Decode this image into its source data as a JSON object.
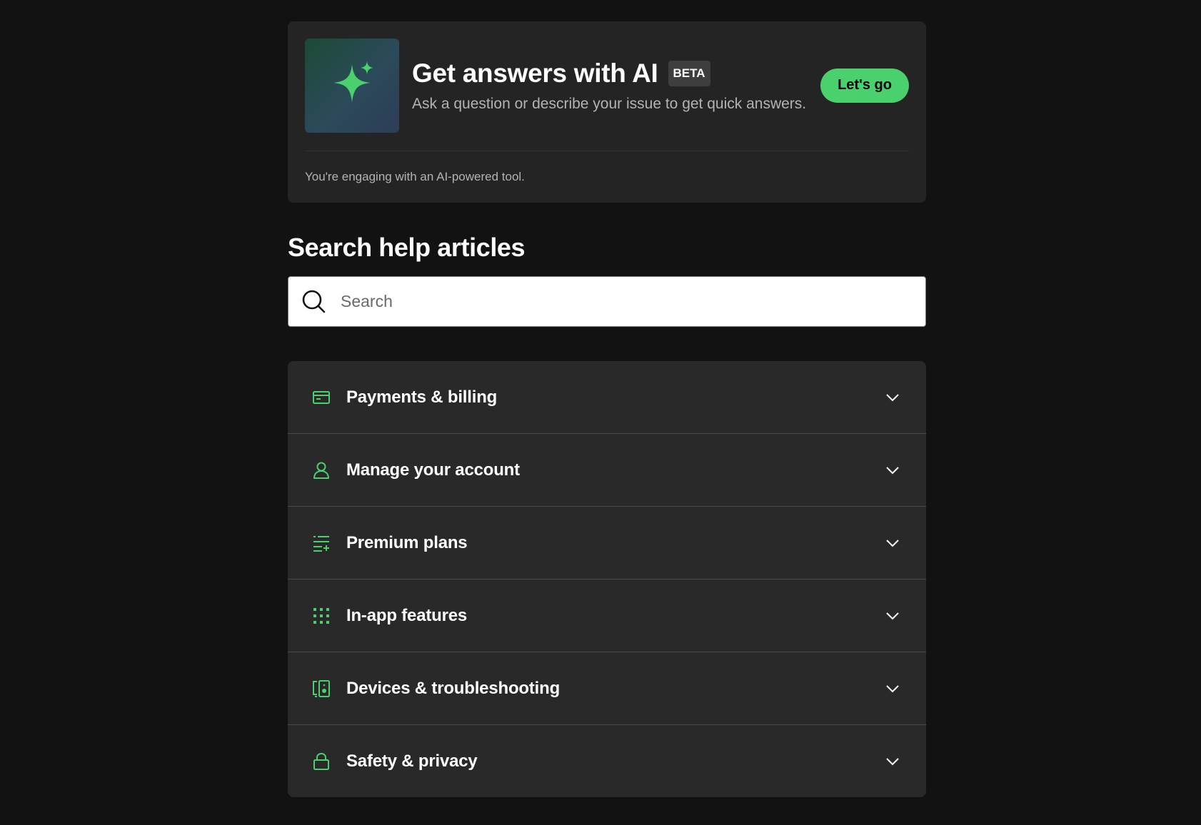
{
  "ai_card": {
    "title": "Get answers with AI",
    "badge": "BETA",
    "subtitle": "Ask a question or describe your issue to get quick answers.",
    "button_label": "Let's go",
    "disclaimer": "You're engaging with an AI-powered tool.",
    "tile_icon": "sparkle-icon"
  },
  "search": {
    "heading": "Search help articles",
    "placeholder": "Search",
    "value": "",
    "icon": "search-icon"
  },
  "categories": [
    {
      "label": "Payments & billing",
      "icon": "credit-card-icon"
    },
    {
      "label": "Manage your account",
      "icon": "user-icon"
    },
    {
      "label": "Premium plans",
      "icon": "sliders-icon"
    },
    {
      "label": "In-app features",
      "icon": "grid-icon"
    },
    {
      "label": "Devices & troubleshooting",
      "icon": "devices-icon"
    },
    {
      "label": "Safety & privacy",
      "icon": "lock-icon"
    }
  ],
  "colors": {
    "background": "#121212",
    "card": "#242424",
    "accent": "#4ad06c",
    "category_bg": "#292929"
  }
}
